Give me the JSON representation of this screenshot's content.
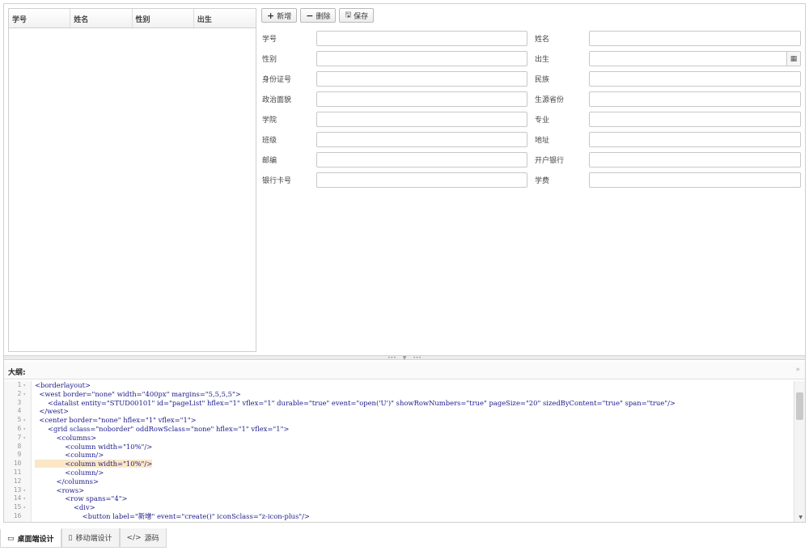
{
  "grid": {
    "columns": [
      "学号",
      "姓名",
      "性别",
      "出生"
    ]
  },
  "toolbar": {
    "add_label": "新增",
    "delete_label": "删除",
    "save_label": "保存"
  },
  "form": {
    "rows": [
      {
        "left_label": "学号",
        "right_label": "姓名"
      },
      {
        "left_label": "性别",
        "right_label": "出生"
      },
      {
        "left_label": "身份证号",
        "right_label": "民族"
      },
      {
        "left_label": "政治面貌",
        "right_label": "生源省份"
      },
      {
        "left_label": "学院",
        "right_label": "专业"
      },
      {
        "left_label": "班级",
        "right_label": "地址"
      },
      {
        "left_label": "邮编",
        "right_label": "开户银行"
      },
      {
        "left_label": "银行卡号",
        "right_label": "学费"
      }
    ]
  },
  "outline": {
    "title": "大纲:",
    "code_lines": [
      "<borderlayout>",
      "  <west border=\"none\" width=\"400px\" margins=\"5,5,5,5\">",
      "      <datalist entity=\"STUD00101\" id=\"pageList\" hflex=\"1\" vflex=\"1\" durable=\"true\" event=\"open('U')\" showRowNumbers=\"true\" pageSize=\"20\" sizedByContent=\"true\" span=\"true\"/>",
      "  </west>",
      "  <center border=\"none\" hflex=\"1\" vflex=\"1\">",
      "      <grid sclass=\"noborder\" oddRowSclass=\"none\" hflex=\"1\" vflex=\"1\">",
      "          <columns>",
      "              <column width=\"10%\"/>",
      "              <column/>",
      "              <column width=\"10%\"/>",
      "              <column/>",
      "          </columns>",
      "          <rows>",
      "              <row spans=\"4\">",
      "                  <div>",
      "                      <button label=\"新增\" event=\"create()\" iconSclass=\"z-icon-plus\"/>"
    ],
    "line_numbers": [
      "1",
      "2",
      "3",
      "4",
      "5",
      "6",
      "7",
      "8",
      "9",
      "10",
      "11",
      "12",
      "13",
      "14",
      "15",
      "16"
    ]
  },
  "tabs": [
    {
      "label": "桌面端设计",
      "icon": "desktop-icon"
    },
    {
      "label": "移动端设计",
      "icon": "mobile-icon"
    },
    {
      "label": "源码",
      "icon": "code-icon"
    }
  ]
}
